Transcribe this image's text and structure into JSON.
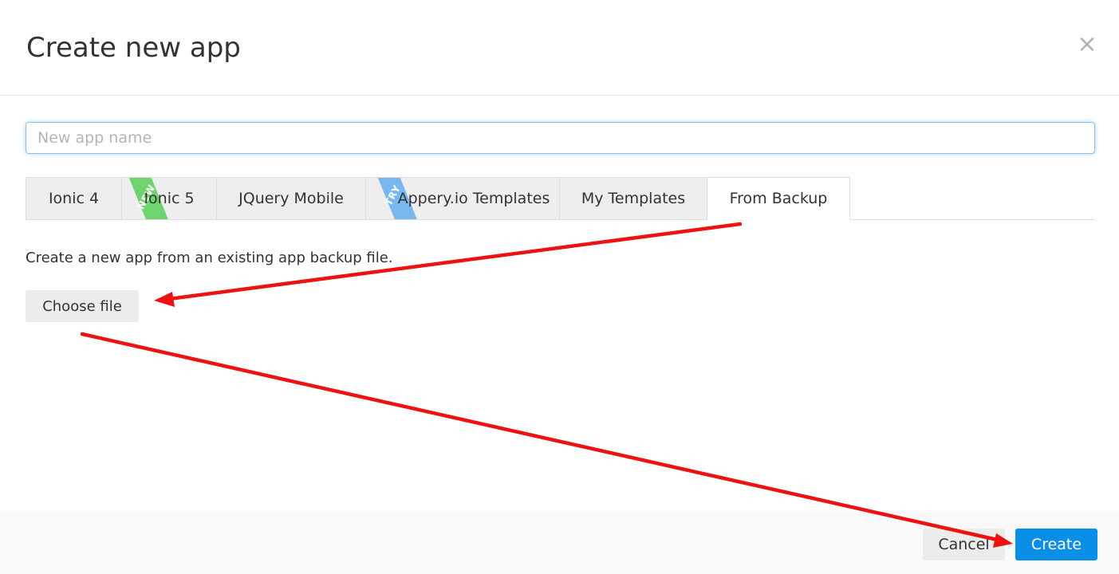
{
  "dialog": {
    "title": "Create new app",
    "close_icon": "close-icon",
    "close_glyph": "×"
  },
  "app_name_input": {
    "value": "",
    "placeholder": "New app name"
  },
  "tabs": [
    {
      "label": "Ionic 4",
      "active": false
    },
    {
      "label": "Ionic 5",
      "active": false,
      "ribbon": "NEW",
      "ribbon_color": "#6fd36f"
    },
    {
      "label": "JQuery Mobile",
      "active": false
    },
    {
      "label": "Appery.io Templates",
      "active": false,
      "ribbon": "TRY",
      "ribbon_color": "#79b8ee"
    },
    {
      "label": "My Templates",
      "active": false
    },
    {
      "label": "From Backup",
      "active": true
    }
  ],
  "from_backup": {
    "description": "Create a new app from an existing app backup file.",
    "choose_file_label": "Choose file"
  },
  "footer": {
    "cancel_label": "Cancel",
    "create_label": "Create"
  },
  "colors": {
    "primary": "#0a8fe9",
    "annotation_arrow": "#ee1111",
    "new_ribbon": "#6fd36f",
    "try_ribbon": "#79b8ee"
  },
  "annotations": {
    "arrows": [
      {
        "from": "tab-from-backup",
        "to": "choose-file-button"
      },
      {
        "from": "choose-file-button",
        "to": "create-button"
      }
    ]
  }
}
